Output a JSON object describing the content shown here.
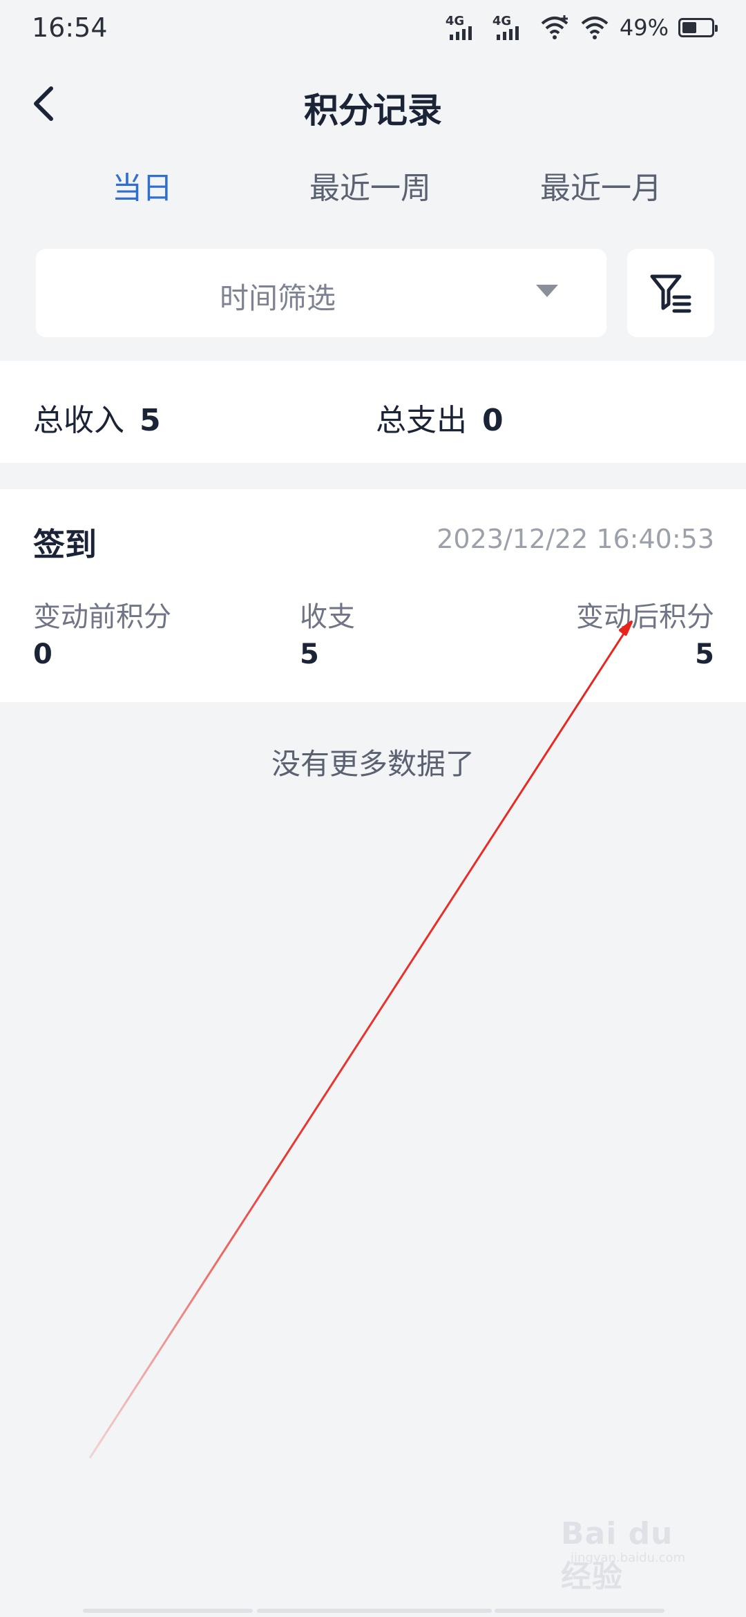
{
  "status_bar": {
    "time": "16:54",
    "signal_1_label": "4G",
    "signal_2_label": "4G",
    "battery_text": "49%",
    "battery_level": 0.49
  },
  "nav": {
    "title": "积分记录"
  },
  "tabs": [
    {
      "label": "当日",
      "active": true
    },
    {
      "label": "最近一周",
      "active": false
    },
    {
      "label": "最近一月",
      "active": false
    }
  ],
  "filter": {
    "placeholder": "时间筛选"
  },
  "summary": {
    "income_label": "总收入",
    "income_value": "5",
    "expense_label": "总支出",
    "expense_value": "0"
  },
  "record": {
    "title": "签到",
    "time": "2023/12/22 16:40:53",
    "before_label": "变动前积分",
    "before_value": "0",
    "change_label": "收支",
    "change_value": "5",
    "after_label": "变动后积分",
    "after_value": "5"
  },
  "footer_text": "没有更多数据了",
  "watermark": {
    "text": "Bai du 经验",
    "sub": "jingyan.baidu.com"
  },
  "colors": {
    "accent": "#2f6fcf",
    "annotation": "#e8231c",
    "background": "#f3f4f6"
  }
}
